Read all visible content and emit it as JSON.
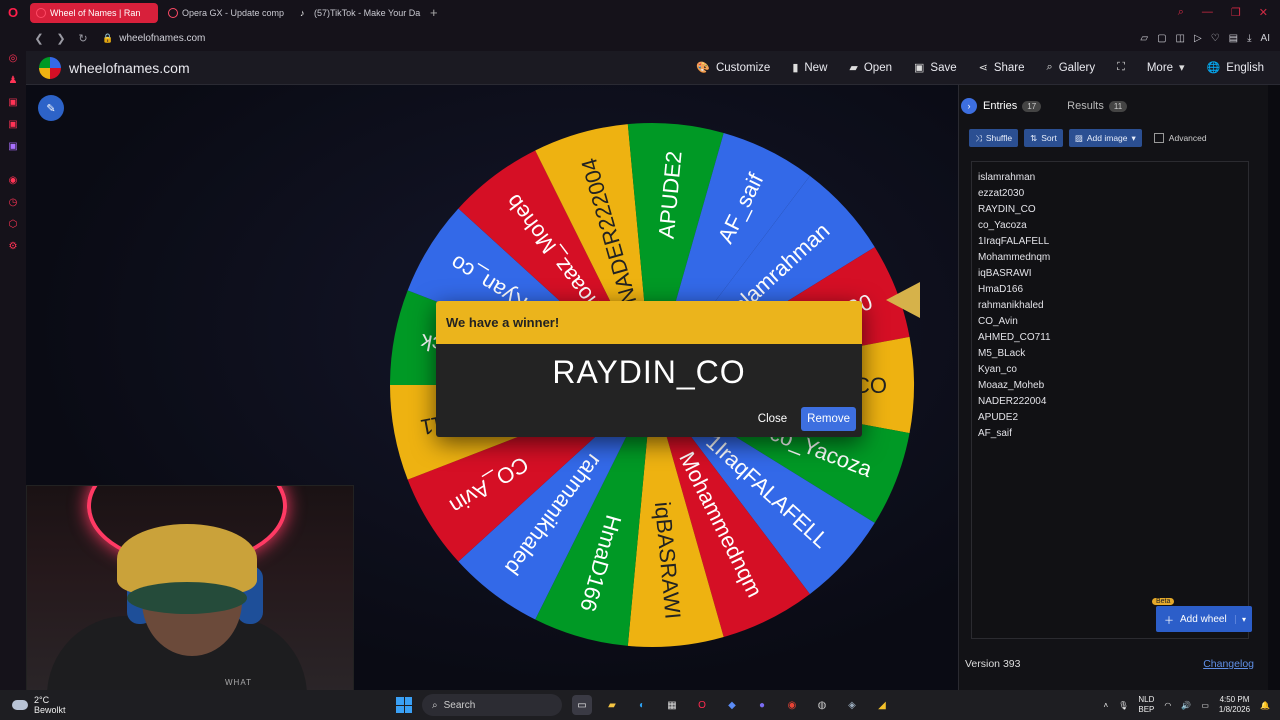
{
  "browser": {
    "tabs": [
      {
        "label": "Wheel of Names | Ran",
        "active": true
      },
      {
        "label": "Opera GX - Update comp",
        "active": false
      },
      {
        "label": "(57)TikTok - Make Your Da",
        "active": false
      }
    ],
    "url": "wheelofnames.com"
  },
  "header": {
    "site_name": "wheelofnames.com",
    "menu": [
      "Customize",
      "New",
      "Open",
      "Save",
      "Share",
      "Gallery",
      "More",
      "English"
    ]
  },
  "wheel": {
    "segments": [
      "islamrahman",
      "ezzat2030",
      "RAYDIN_CO",
      "co_Yacoza",
      "1IraqFALAFELL",
      "Mohammednqm",
      "iqBASRAWI",
      "HmaD166",
      "rahmanikhaled",
      "CO_Avin",
      "AHMED_CO711",
      "M5_BLack",
      "Kyan_co",
      "Moaaz_Moheb",
      "NADER222004",
      "APUDE2",
      "AF_saif"
    ],
    "colors": [
      "#3369e8",
      "#d50f25",
      "#eeb211",
      "#009925"
    ]
  },
  "modal": {
    "title": "We have a winner!",
    "winner": "RAYDIN_CO",
    "close_label": "Close",
    "remove_label": "Remove"
  },
  "panel": {
    "tab_entries": "Entries",
    "entries_count": "17",
    "tab_results": "Results",
    "results_count": "11",
    "shuffle": "Shuffle",
    "sort": "Sort",
    "add_image": "Add image",
    "advanced": "Advanced",
    "entries": [
      "islamrahman",
      "ezzat2030",
      "RAYDIN_CO",
      "co_Yacoza",
      "1IraqFALAFELL",
      "Mohammednqm",
      "iqBASRAWI",
      "HmaD166",
      "rahmanikhaled",
      "CO_Avin",
      "AHMED_CO711",
      "M5_BLack",
      "Kyan_co",
      "Moaaz_Moheb",
      "NADER222004",
      "APUDE2",
      "AF_saif"
    ],
    "add_wheel": "Add wheel",
    "beta": "Beta",
    "version": "Version 393",
    "changelog": "Changelog"
  },
  "webcam": {
    "shirt_text": "WHAT"
  },
  "taskbar": {
    "temperature": "2°C",
    "weather": "Bewolkt",
    "search": "Search",
    "lang1": "NLD",
    "lang2": "BEP",
    "time": "4:50 PM",
    "date": "1/8/2026"
  }
}
